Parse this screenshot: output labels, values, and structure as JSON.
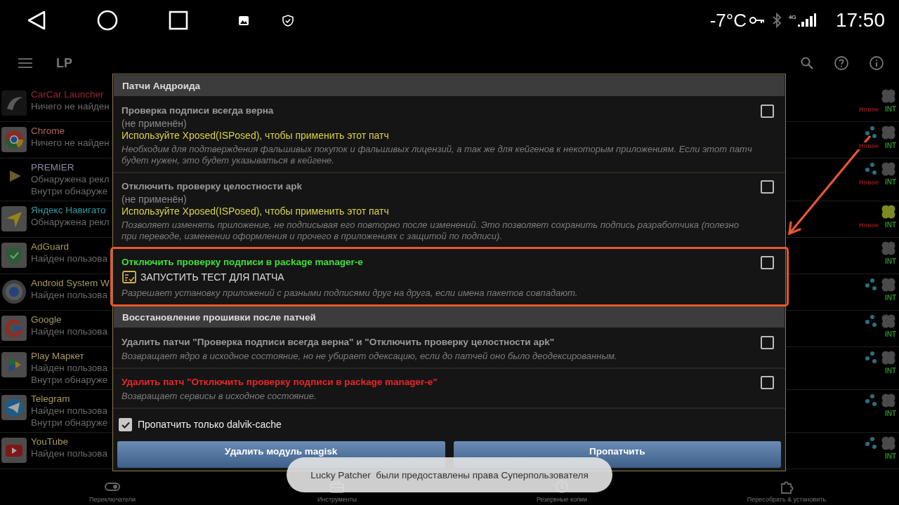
{
  "status_bar": {
    "temperature": "-7°C",
    "network": "4G",
    "time": "17:50"
  },
  "app_bar": {
    "title": "LP"
  },
  "apps": [
    {
      "name": "CarCar Launcher",
      "color": "#9c2436",
      "lines": [
        "Ничего не найден"
      ],
      "dots": false,
      "new_label": "Новое",
      "int_label": "INT",
      "clover_active": false
    },
    {
      "name": "Chrome",
      "color": "#b06a4c",
      "lines": [
        "Ничего не найден"
      ],
      "dots": true,
      "new_label": "Новое",
      "int_label": "INT",
      "clover_active": false
    },
    {
      "name": "PREMIER",
      "color": "#8c8ca8",
      "lines": [
        "Обнаружена рекл",
        "Внутри обнаруже"
      ],
      "dots": true,
      "new_label": "Новое",
      "int_label": "INT",
      "clover_active": false
    },
    {
      "name": "Яндекс Навигато",
      "color": "#3a9ba3",
      "lines": [
        "Обнаружена рекл"
      ],
      "dots": false,
      "new_label": "Новое",
      "int_label": "INT",
      "clover_active": true
    },
    {
      "name": "AdGuard",
      "color": "#a89a62",
      "lines": [
        "Найден пользова"
      ],
      "dots": false,
      "int_label": "INT",
      "clover_active": false
    },
    {
      "name": "Android System W",
      "color": "#a89a62",
      "lines": [
        "Найден пользова"
      ],
      "dots": true,
      "int_label": "INT",
      "clover_active": false
    },
    {
      "name": "Google",
      "color": "#a89a62",
      "lines": [
        "Найден пользова"
      ],
      "dots": true,
      "int_label": "INT",
      "clover_active": false
    },
    {
      "name": "Play Маркет",
      "color": "#a89a62",
      "lines": [
        "Найден пользова",
        "Внутри обнаруже"
      ],
      "dots": true,
      "int_label": "INT",
      "clover_active": false
    },
    {
      "name": "Telegram",
      "color": "#a89a62",
      "lines": [
        "Найден пользова",
        "Внутри обнаруже"
      ],
      "dots": true,
      "int_label": "INT",
      "clover_active": false
    },
    {
      "name": "YouTube",
      "color": "#a89a62",
      "lines": [
        "Найден пользова"
      ],
      "dots": true,
      "int_label": "INT",
      "clover_active": false
    }
  ],
  "dialog": {
    "sections": [
      {
        "title": "Патчи Андроида",
        "patches": [
          {
            "kind": "normal",
            "title": "Проверка подписи всегда верна",
            "status": "(не применён)",
            "note": "Используйте Xposed(ISPosed), чтобы применить этот патч",
            "description": "Необходим для подтверждения фальшивых покупок и фальшивых лицензий, а так же для кейгенов к некоторым приложениям. Если этот патч будет нужен, это будет указываться в кейгене.",
            "checked": false,
            "highlighted": false
          },
          {
            "kind": "normal",
            "title": "Отключить проверку целостности apk",
            "status": "(не применён)",
            "note": "Используйте Xposed(ISPosed), чтобы применить этот патч",
            "description": "Позволяет изменять приложение, не подписывая его повторно после изменений. Это позволяет сохранить подпись разработчика (полезно при переводе, изменении оформления и прочего в приложениях с защитой по подписи).",
            "checked": false,
            "highlighted": false
          },
          {
            "kind": "enabled",
            "title": "Отключить проверку подписи в package manager-e",
            "test_button": "ЗАПУСТИТЬ ТЕСТ ДЛЯ ПАТЧА",
            "description": "Разрешает установку приложений с разными подписями друг на друга, если имена пакетов совпадают.",
            "checked": false,
            "highlighted": true
          }
        ]
      },
      {
        "title": "Восстановление прошивки после патчей",
        "patches": [
          {
            "kind": "normal",
            "title": "Удалить патчи \"Проверка подписи всегда верна\" и \"Отключить проверку целостности apk\"",
            "description": "Возвращает ядро в исходное состояние, но не убирает одексацию, если до патчей оно было деодексированным.",
            "checked": false,
            "highlighted": false
          },
          {
            "kind": "danger",
            "title": "Удалить патч \"Отключить проверку подписи в package manager-e\"",
            "description": "Возвращает сервисы в исходное состояние.",
            "checked": false,
            "highlighted": false
          }
        ]
      }
    ],
    "dalvik_option": {
      "label": "Пропатчить только dalvik-cache",
      "checked": true
    },
    "buttons": [
      "Удалить модуль magisk",
      "Пропатчить"
    ]
  },
  "toast": "Lucky Patcher  были предоставлены права Суперпользователя",
  "bottom_nav": [
    {
      "label": "Переключатели"
    },
    {
      "label": "Инструменты"
    },
    {
      "label": "Резервные копии"
    },
    {
      "label": "Пересобрать & установить"
    }
  ]
}
